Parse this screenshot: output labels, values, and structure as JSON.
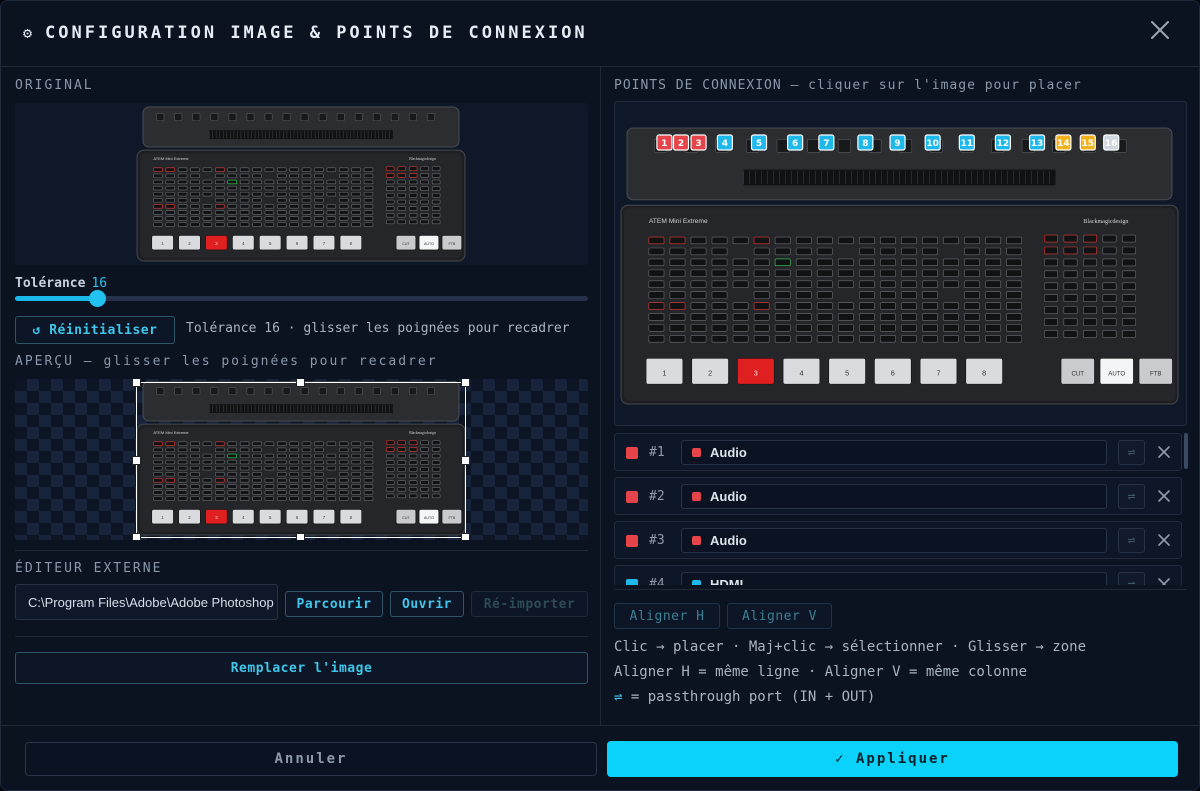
{
  "dialog": {
    "title": "CONFIGURATION IMAGE & POINTS DE CONNEXION",
    "close_icon": "close-icon"
  },
  "left": {
    "original_label": "ORIGINAL",
    "tolerance": {
      "label": "Tolérance",
      "value": "16",
      "fraction": 0.143
    },
    "reset_button": "↺ Réinitialiser",
    "reset_hint": "Tolérance 16 · glisser les poignées pour recadrer",
    "preview_label": "APERÇU — glisser les poignées pour recadrer",
    "external_editor": {
      "label": "ÉDITEUR EXTERNE",
      "path": "C:\\Program Files\\Adobe\\Adobe Photoshop",
      "browse": "Parcourir",
      "open": "Ouvrir",
      "reimport": "Ré-importer"
    },
    "replace_button": "Remplacer l'image"
  },
  "device": {
    "model": "ATEM Mini Extreme",
    "brand": "Blackmagicdesign",
    "main_buttons": [
      "1",
      "2",
      "3",
      "4",
      "5",
      "6",
      "7",
      "8"
    ],
    "transition_buttons": [
      "CUT",
      "AUTO",
      "FTB"
    ]
  },
  "right": {
    "points_label": "POINTS DE CONNEXION — cliquer sur l'image pour placer",
    "markers": [
      {
        "n": "1",
        "color": "#e5444a"
      },
      {
        "n": "2",
        "color": "#e5444a"
      },
      {
        "n": "3",
        "color": "#e5444a"
      },
      {
        "n": "4",
        "color": "#1fb8ea"
      },
      {
        "n": "5",
        "color": "#1fb8ea"
      },
      {
        "n": "6",
        "color": "#1fb8ea"
      },
      {
        "n": "7",
        "color": "#1fb8ea"
      },
      {
        "n": "8",
        "color": "#1fb8ea"
      },
      {
        "n": "9",
        "color": "#1fb8ea"
      },
      {
        "n": "10",
        "color": "#1fb8ea"
      },
      {
        "n": "11",
        "color": "#1fb8ea"
      },
      {
        "n": "12",
        "color": "#1fb8ea"
      },
      {
        "n": "13",
        "color": "#1fb8ea"
      },
      {
        "n": "14",
        "color": "#f2b21c"
      },
      {
        "n": "15",
        "color": "#f2b21c"
      },
      {
        "n": "16",
        "color": "#cfd6de"
      }
    ],
    "connections": [
      {
        "num": "#1",
        "type": "Audio",
        "color": "#e5444a"
      },
      {
        "num": "#2",
        "type": "Audio",
        "color": "#e5444a"
      },
      {
        "num": "#3",
        "type": "Audio",
        "color": "#e5444a"
      },
      {
        "num": "#4",
        "type": "HDMI",
        "color": "#1fb8ea"
      }
    ],
    "passthrough_symbol": "⇌",
    "align_h": "Aligner H",
    "align_v": "Aligner V",
    "help": [
      "Clic → placer · Maj+clic → sélectionner · Glisser → zone",
      "Aligner H = même ligne · Aligner V = même colonne",
      "⇌ = passthrough port (IN + OUT)"
    ]
  },
  "footer": {
    "cancel": "Annuler",
    "apply": "✓ Appliquer"
  }
}
